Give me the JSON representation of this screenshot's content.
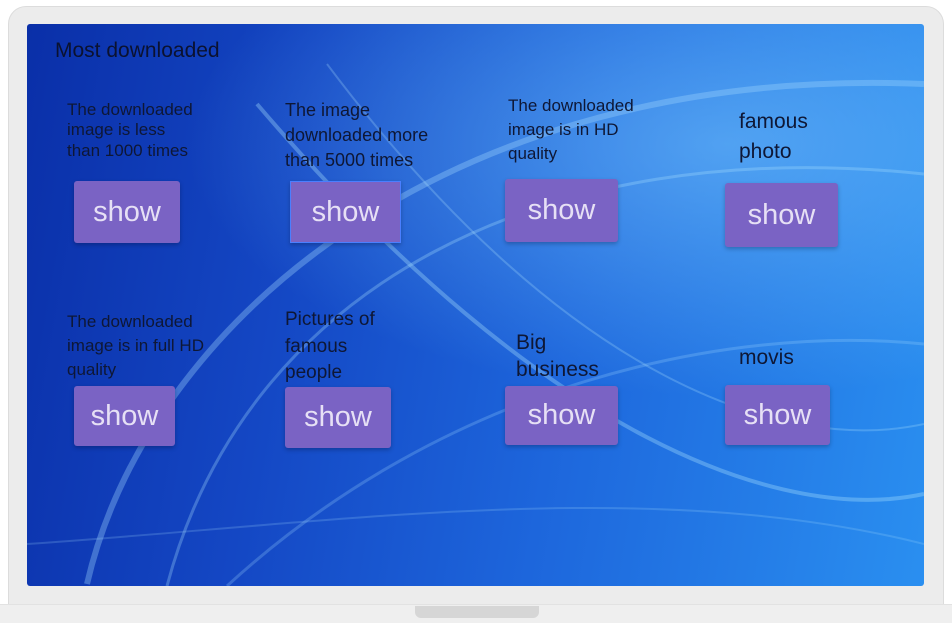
{
  "page": {
    "title": "Most downloaded"
  },
  "cards": [
    {
      "text": "The downloaded image is less than 1000 times",
      "button": "show"
    },
    {
      "text": "The image downloaded more than 5000 times",
      "button": "show"
    },
    {
      "text": "The downloaded image is in HD quality",
      "button": "show"
    },
    {
      "text": "famous photo",
      "button": "show"
    },
    {
      "text": "The downloaded image is in full HD quality",
      "button": "show"
    },
    {
      "text": "Pictures of famous people",
      "button": "show"
    },
    {
      "text": "Big business",
      "button": "show"
    },
    {
      "text": "movis",
      "button": "show"
    }
  ],
  "colors": {
    "button": "#7a63c4",
    "button_text": "#e6e0f5",
    "background_dark": "#0a2fa8",
    "background_light": "#2a8ff0"
  }
}
